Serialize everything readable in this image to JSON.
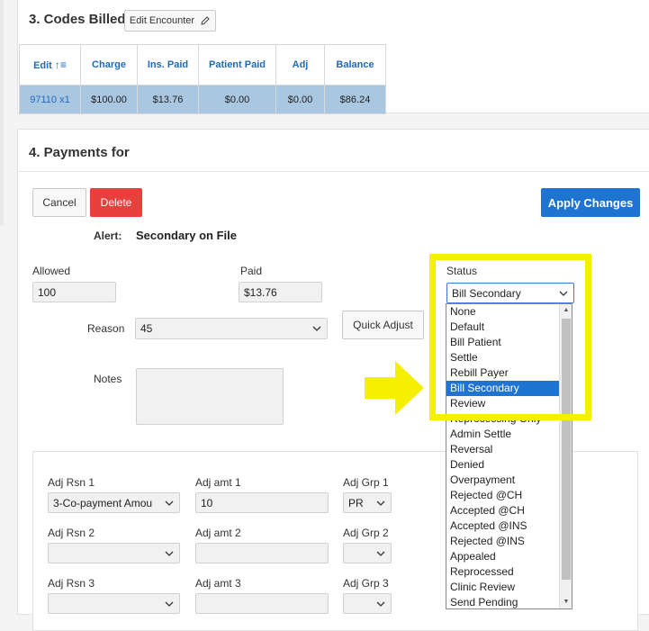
{
  "section3": {
    "title": "3. Codes Billed",
    "edit_encounter_label": "Edit Encounter",
    "columns": [
      "Edit",
      "Charge",
      "Ins. Paid",
      "Patient Paid",
      "Adj",
      "Balance"
    ],
    "row": [
      "97110 x1",
      "$100.00",
      "$13.76",
      "$0.00",
      "$0.00",
      "$86.24"
    ]
  },
  "section4": {
    "title": "4. Payments for",
    "cancel_label": "Cancel",
    "delete_label": "Delete",
    "apply_label": "Apply Changes",
    "alert_label": "Alert:",
    "alert_value": "Secondary on File",
    "allowed_label": "Allowed",
    "allowed_value": "100",
    "paid_label": "Paid",
    "paid_value": "$13.76",
    "status_label": "Status",
    "status_value": "Bill Secondary",
    "reason_label": "Reason",
    "reason_value": "45",
    "quick_adjust_label": "Quick Adjust",
    "notes_label": "Notes",
    "notes_value": ""
  },
  "adjustments": {
    "rows": [
      {
        "rsn_label": "Adj Rsn 1",
        "rsn_value": "3-Co-payment Amou",
        "amt_label": "Adj amt 1",
        "amt_value": "10",
        "grp_label": "Adj Grp 1",
        "grp_value": "PR"
      },
      {
        "rsn_label": "Adj Rsn 2",
        "rsn_value": "",
        "amt_label": "Adj amt 2",
        "amt_value": "",
        "grp_label": "Adj Grp 2",
        "grp_value": ""
      },
      {
        "rsn_label": "Adj Rsn 3",
        "rsn_value": "",
        "amt_label": "Adj amt 3",
        "amt_value": "",
        "grp_label": "Adj Grp 3",
        "grp_value": ""
      }
    ]
  },
  "status_dropdown": {
    "options": [
      "None",
      "Default",
      "Bill Patient",
      "Settle",
      "Rebill Payer",
      "Bill Secondary",
      "Review",
      "Reprocessing Only",
      "Admin Settle",
      "Reversal",
      "Denied",
      "Overpayment",
      "Rejected @CH",
      "Accepted @CH",
      "Accepted @INS",
      "Rejected @INS",
      "Appealed",
      "Reprocessed",
      "Clinic Review",
      "Send Pending"
    ],
    "selected_index": 5
  },
  "colors": {
    "highlight_box": "#f5ef00",
    "arrow": "#f5ef00",
    "apply_button": "#1f73d1",
    "delete_button": "#e8403d",
    "row_selected": "#a9c7e1",
    "option_selected": "#1f73d1"
  },
  "icons": {
    "edit_icon": "pencil-icon",
    "sort_icon": "sort-asc-icon",
    "select_chevron": "chevron-down-icon",
    "annotation_arrow": "arrow-right-icon"
  }
}
